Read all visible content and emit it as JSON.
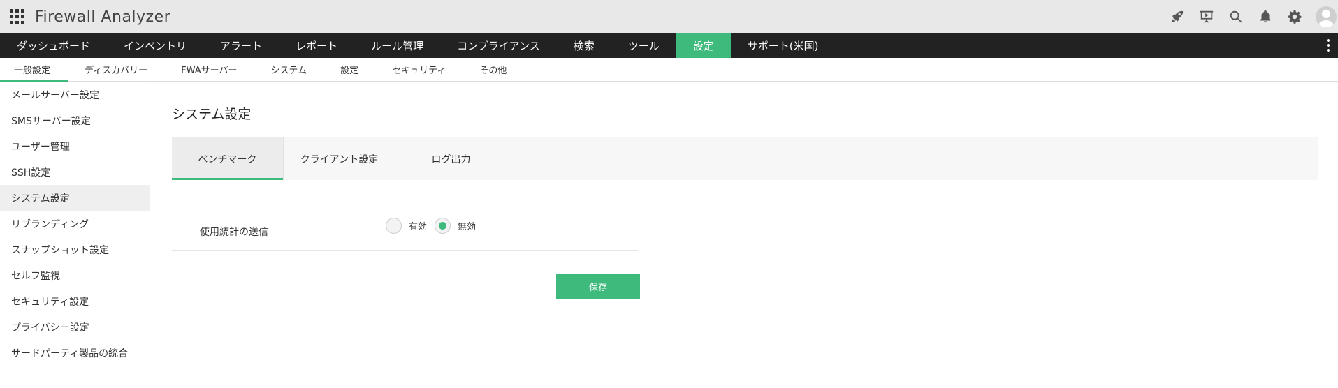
{
  "header": {
    "title": "Firewall Analyzer",
    "icons": [
      "apps-grid-icon",
      "rocket-icon",
      "presentation-icon",
      "search-icon",
      "bell-icon",
      "gear-icon",
      "user-avatar-icon"
    ]
  },
  "main_nav": {
    "items": [
      {
        "label": "ダッシュボード"
      },
      {
        "label": "インベントリ"
      },
      {
        "label": "アラート"
      },
      {
        "label": "レポート"
      },
      {
        "label": "ルール管理"
      },
      {
        "label": "コンプライアンス"
      },
      {
        "label": "検索"
      },
      {
        "label": "ツール"
      },
      {
        "label": "設定"
      },
      {
        "label": "サポート(米国)"
      }
    ],
    "active_index": 8
  },
  "sub_nav": {
    "items": [
      {
        "label": "一般設定"
      },
      {
        "label": "ディスカバリー"
      },
      {
        "label": "FWAサーバー"
      },
      {
        "label": "システム"
      },
      {
        "label": "設定"
      },
      {
        "label": "セキュリティ"
      },
      {
        "label": "その他"
      }
    ],
    "active_index": 0
  },
  "sidebar": {
    "items": [
      {
        "label": "メールサーバー設定"
      },
      {
        "label": "SMSサーバー設定"
      },
      {
        "label": "ユーザー管理"
      },
      {
        "label": "SSH設定"
      },
      {
        "label": "システム設定"
      },
      {
        "label": "リブランディング"
      },
      {
        "label": "スナップショット設定"
      },
      {
        "label": "セルフ監視"
      },
      {
        "label": "セキュリティ設定"
      },
      {
        "label": "プライバシー設定"
      },
      {
        "label": "サードパーティ製品の統合"
      }
    ],
    "active_index": 4
  },
  "main": {
    "page_title": "システム設定",
    "tabs": [
      {
        "label": "ベンチマーク"
      },
      {
        "label": "クライアント設定"
      },
      {
        "label": "ログ出力"
      }
    ],
    "active_tab": 0,
    "form": {
      "usage_stats_label": "使用統計の送信",
      "options": [
        {
          "label": "有効",
          "checked": false
        },
        {
          "label": "無効",
          "checked": true
        }
      ]
    },
    "save_label": "保存"
  },
  "colors": {
    "accent": "#3dba7c",
    "header_bg": "#e8e8e8",
    "nav_bg": "#222222"
  }
}
